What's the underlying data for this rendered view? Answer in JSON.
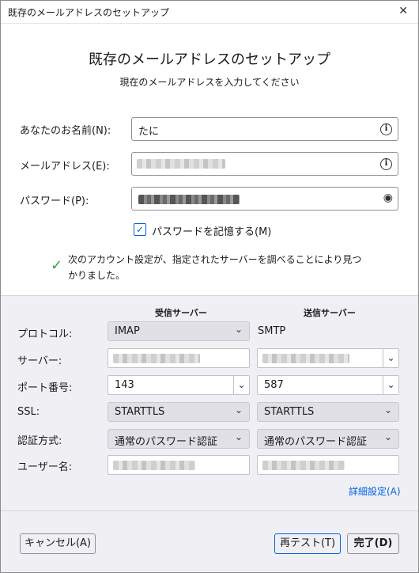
{
  "window": {
    "title": "既存のメールアドレスのセットアップ",
    "close_glyph": "✕"
  },
  "header": {
    "title": "既存のメールアドレスのセットアップ",
    "subtitle": "現在のメールアドレスを入力してください"
  },
  "form": {
    "name_label": "あなたのお名前(N):",
    "name_value": "たに",
    "email_label": "メールアドレス(E):",
    "password_label": "パスワード(P):",
    "remember_label": "パスワードを記憶する(M)",
    "remember_checked": true,
    "info_glyph": "i",
    "eye_glyph": "◉"
  },
  "found_message": "次のアカウント設定が、指定されたサーバーを調べることにより見つかりました。",
  "server": {
    "incoming_header": "受信サーバー",
    "outgoing_header": "送信サーバー",
    "protocol_label": "プロトコル:",
    "protocol_in": "IMAP",
    "protocol_out": "SMTP",
    "server_label": "サーバー:",
    "port_label": "ポート番号:",
    "port_in": "143",
    "port_out": "587",
    "ssl_label": "SSL:",
    "ssl_in": "STARTTLS",
    "ssl_out": "STARTTLS",
    "auth_label": "認証方式:",
    "auth_in": "通常のパスワード認証",
    "auth_out": "通常のパスワード認証",
    "user_label": "ユーザー名:",
    "advanced_link": "詳細設定(A)"
  },
  "buttons": {
    "cancel": "キャンセル(A)",
    "retest": "再テスト(T)",
    "done": "完了(D)"
  },
  "colors": {
    "accent": "#0060df",
    "success": "#2ea043",
    "panel_bg": "#f0f0f4"
  }
}
